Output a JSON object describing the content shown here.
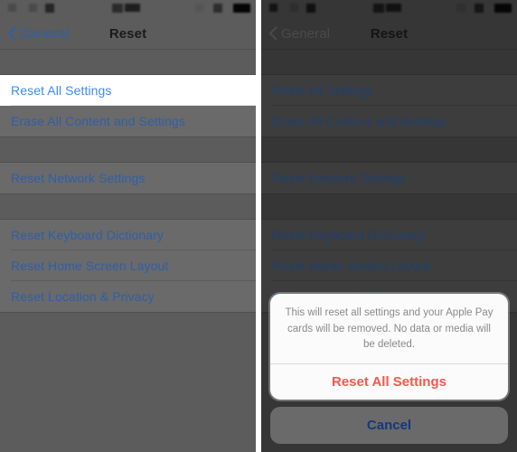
{
  "screen": {
    "app": "Settings",
    "nav": {
      "back_label": "General",
      "back_icon": "chevron-left-icon",
      "title": "Reset"
    },
    "status_bar": {
      "redacted": true,
      "icon_names": [
        "signal-icon",
        "wifi-icon",
        "carrier-icon",
        "clock-redacted",
        "location-icon",
        "bluetooth-icon",
        "battery-icon"
      ]
    },
    "list": {
      "group_one": [
        {
          "label": "Reset All Settings"
        },
        {
          "label": "Erase All Content and Settings"
        }
      ],
      "group_two": [
        {
          "label": "Reset Network Settings"
        }
      ],
      "group_three": [
        {
          "label": "Reset Keyboard Dictionary"
        },
        {
          "label": "Reset Home Screen Layout"
        },
        {
          "label": "Reset Location & Privacy"
        }
      ]
    }
  },
  "action_sheet": {
    "message": "This will reset all settings and your Apple Pay cards will be removed. No data or media will be deleted.",
    "destructive_label": "Reset All Settings",
    "cancel_label": "Cancel"
  },
  "colors": {
    "tint_blue": "#3b8cf7",
    "destructive_red": "#f9564c",
    "dim_background": "#5c5c5c",
    "modal_dim_background": "#363636",
    "highlight_row": "#ffffff"
  }
}
